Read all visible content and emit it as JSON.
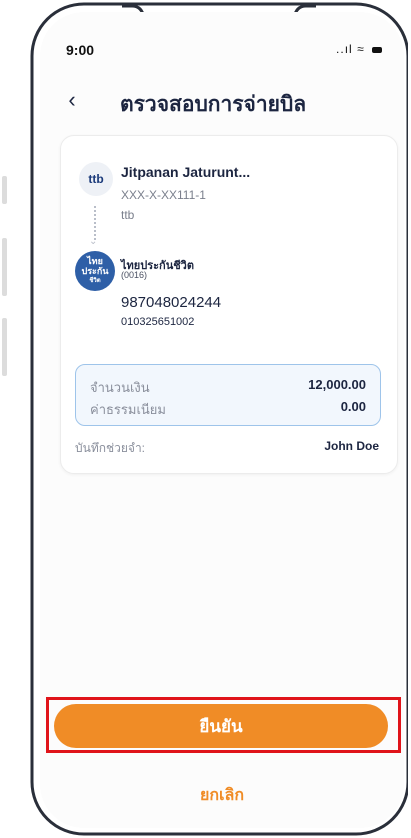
{
  "status_bar": {
    "time": "9:00",
    "signal": "..ıl",
    "wifi": "≈"
  },
  "header": {
    "title": "ตรวจสอบการจ่ายบิล"
  },
  "from_account": {
    "logo_text": "ttb",
    "name": "Jitpanan Jaturunt...",
    "account_number": "XXX-X-XX111-1",
    "bank": "ttb"
  },
  "biller": {
    "logo_lines": [
      "ไทย",
      "ประกัน",
      "ชีวิต"
    ],
    "name": "ไทยประกันชีวิต",
    "code": "(0016)",
    "reference_1": "987048024244",
    "reference_2": "010325651002"
  },
  "amounts": {
    "amount_label": "จำนวนเงิน",
    "amount_value": "12,000.00",
    "fee_label": "ค่าธรรมเนียม",
    "fee_value": "0.00"
  },
  "memo": {
    "label": "บันทึกช่วยจำ:",
    "value": "John Doe"
  },
  "buttons": {
    "confirm": "ยืนยัน",
    "cancel": "ยกเลิก"
  },
  "colors": {
    "accent": "#f08c26",
    "highlight": "#e0141a",
    "amount_border": "#9ec4ea"
  }
}
